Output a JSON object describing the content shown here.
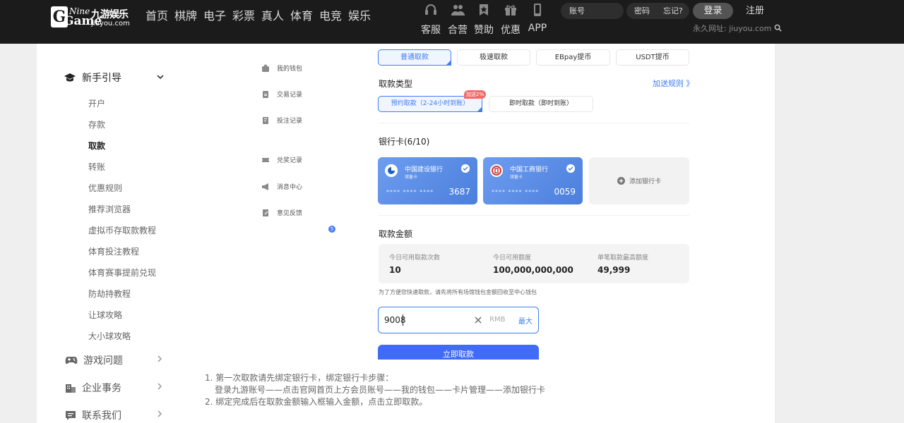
{
  "header": {
    "logo": {
      "nine": "Nine",
      "game": "Game",
      "cn": "九游娱乐",
      "url": "jiuyou.com"
    },
    "nav": [
      "首页",
      "棋牌",
      "电子",
      "彩票",
      "真人",
      "体育",
      "电竞",
      "娱乐"
    ],
    "services": [
      {
        "label": "客服",
        "icon": "headset-icon"
      },
      {
        "label": "合营",
        "icon": "partner-icon"
      },
      {
        "label": "赞助",
        "icon": "sponsor-icon"
      },
      {
        "label": "优惠",
        "icon": "gift-icon"
      },
      {
        "label": "APP",
        "icon": "phone-icon"
      }
    ],
    "account_placeholder": "账号",
    "password_placeholder": "密码",
    "forgot": "忘记?",
    "login": "登录",
    "register": "注册",
    "perm_url": "永久网址: jiuyou.com"
  },
  "left_nav": {
    "guide_title": "新手引导",
    "guide_items": [
      "开户",
      "存款",
      "取款",
      "转账",
      "优惠规则",
      "推荐浏览器",
      "虚拟币存取款教程",
      "体育投注教程",
      "体育赛事提前兑现",
      "防劫持教程",
      "让球攻略",
      "大小球攻略"
    ],
    "active_item": "取款",
    "sections": [
      {
        "label": "游戏问题",
        "icon": "gamepad-icon"
      },
      {
        "label": "企业事务",
        "icon": "building-icon"
      },
      {
        "label": "联系我们",
        "icon": "chat-icon"
      }
    ]
  },
  "mid_nav": {
    "items": [
      {
        "label": "我的钱包",
        "icon": "wallet-icon"
      },
      {
        "label": "交易记录",
        "icon": "receipt-icon"
      },
      {
        "label": "投注记录",
        "icon": "bet-record-icon"
      },
      {
        "label": "兑奖记录",
        "icon": "ticket-icon"
      },
      {
        "label": "消息中心",
        "icon": "megaphone-icon"
      },
      {
        "label": "意见反馈",
        "icon": "feedback-icon"
      }
    ],
    "message_badge": "5"
  },
  "withdraw": {
    "tabs": [
      "普通取款",
      "极速取款",
      "EBpay提币",
      "USDT提币"
    ],
    "type_title": "取款类型",
    "rules_link": "加送规则 》",
    "types": [
      "预约取款（2-24小时到账）",
      "即时取款（即时到账）"
    ],
    "bonus_badge": "加送2%",
    "bank_title": "银行卡(6/10)",
    "cards": [
      {
        "bank": "中国建设银行",
        "type": "储蓄卡",
        "mask": "**** **** ****",
        "last4": "3687"
      },
      {
        "bank": "中国工商银行",
        "type": "储蓄卡",
        "mask": "**** **** ****",
        "last4": "0059"
      }
    ],
    "add_card": "添加银行卡",
    "amount_title": "取款金额",
    "limits": [
      {
        "label": "今日可用取款次数",
        "value": "10"
      },
      {
        "label": "今日可用额度",
        "value": "100,000,000,000"
      },
      {
        "label": "单笔取款最高额度",
        "value": "49,999"
      }
    ],
    "tip": "为了方便您快速取款，请先将所有场馆钱包金额回收至中心钱包",
    "amount_value": "9008",
    "currency": "RMB",
    "max_label": "最大",
    "submit": "立即取款"
  },
  "notes": [
    "1. 第一次取款请先绑定银行卡，绑定银行卡步骤：",
    "登录九游账号——点击官网首页上方会员账号——我的钱包——卡片管理——添加银行卡",
    "2. 绑定完成后在取款金额输入框输入金额，点击立即取款。"
  ],
  "colors": {
    "accent": "#3f7cf6",
    "header_bg": "#1b1b1b",
    "bonus": "#f26a6a"
  }
}
